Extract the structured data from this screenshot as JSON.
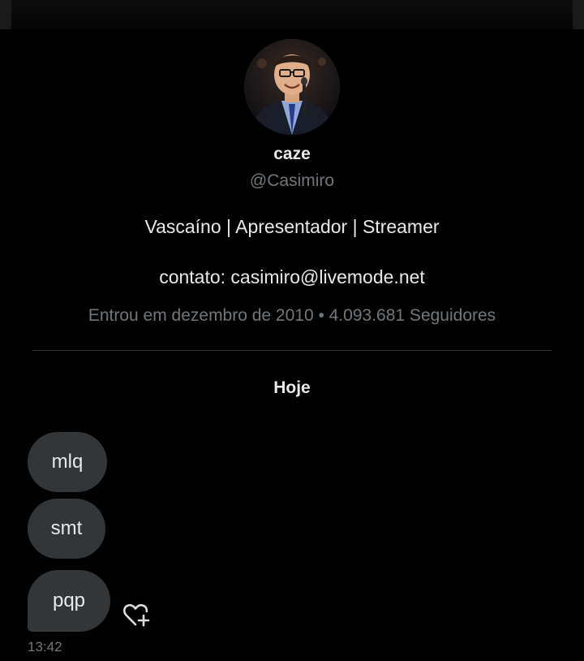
{
  "profile": {
    "display_name": "caze",
    "handle": "@Casimiro",
    "bio": "Vascaíno | Apresentador | Streamer",
    "contact": "contato: casimiro@livemode.net",
    "meta": "Entrou em dezembro de 2010 • 4.093.681 Seguidores"
  },
  "conversation": {
    "date_header": "Hoje",
    "messages": [
      {
        "text": "mlq"
      },
      {
        "text": "smt"
      },
      {
        "text": "pqp"
      }
    ],
    "last_timestamp": "13:42",
    "reaction_icon": "heart-plus-icon"
  },
  "colors": {
    "background": "#000000",
    "bubble": "#333639",
    "primary_text": "#e7e9ea",
    "secondary_text": "#71767b",
    "divider": "#2f3336"
  }
}
